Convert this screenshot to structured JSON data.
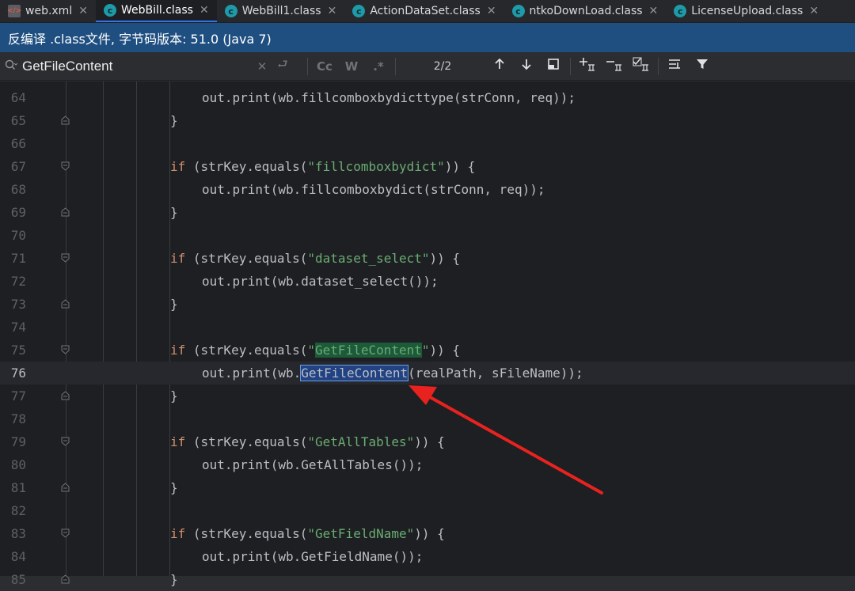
{
  "tabs": [
    {
      "label": "web.xml",
      "icon": "xml-file-icon",
      "active": false
    },
    {
      "label": "WebBill.class",
      "icon": "class-file-icon",
      "active": true
    },
    {
      "label": "WebBill1.class",
      "icon": "class-file-icon",
      "active": false
    },
    {
      "label": "ActionDataSet.class",
      "icon": "class-file-icon",
      "active": false
    },
    {
      "label": "ntkoDownLoad.class",
      "icon": "class-file-icon",
      "active": false
    },
    {
      "label": "LicenseUpload.class",
      "icon": "class-file-icon",
      "active": false
    }
  ],
  "banner": {
    "text": "反编译 .class文件, 字节码版本: 51.0 (Java 7)"
  },
  "search": {
    "query": "GetFileContent",
    "match_case_label": "Cc",
    "words_label": "W",
    "regex_label": ".*",
    "match_count": "2/2"
  },
  "icons": {
    "search": "search-icon",
    "clear": "close-icon",
    "history": "replace-icon",
    "prev": "arrow-up-icon",
    "next": "arrow-down-icon",
    "window": "open-in-window-icon",
    "add_occurrence": "add-occurrence-icon",
    "remove_occurrence": "remove-occurrence-icon",
    "select_all": "select-all-occurrences-icon",
    "filter_options": "filter-options-icon",
    "filter": "filter-icon"
  },
  "colors": {
    "banner": "#1f4f80",
    "keyword": "#cf8e6d",
    "string": "#6aab73",
    "selection": "#214283",
    "arrow": "#e8231f"
  },
  "editor": {
    "lines": [
      {
        "num": "64",
        "indent": 1,
        "parts": [
          {
            "t": "out.print(wb.fillcomboxbydicttype(strConn, req));",
            "c": ""
          }
        ]
      },
      {
        "num": "65",
        "indent": 0,
        "parts": [
          {
            "t": "}",
            "c": ""
          }
        ]
      },
      {
        "num": "66",
        "indent": 0,
        "parts": []
      },
      {
        "num": "67",
        "indent": 0,
        "parts": [
          {
            "t": "if",
            "c": "kw"
          },
          {
            "t": " (strKey.equals(",
            "c": ""
          },
          {
            "t": "\"fillcomboxbydict\"",
            "c": "str"
          },
          {
            "t": ")) {",
            "c": ""
          }
        ]
      },
      {
        "num": "68",
        "indent": 1,
        "parts": [
          {
            "t": "out.print(wb.fillcomboxbydict(strConn, req));",
            "c": ""
          }
        ]
      },
      {
        "num": "69",
        "indent": 0,
        "parts": [
          {
            "t": "}",
            "c": ""
          }
        ]
      },
      {
        "num": "70",
        "indent": 0,
        "parts": []
      },
      {
        "num": "71",
        "indent": 0,
        "parts": [
          {
            "t": "if",
            "c": "kw"
          },
          {
            "t": " (strKey.equals(",
            "c": ""
          },
          {
            "t": "\"dataset_select\"",
            "c": "str"
          },
          {
            "t": ")) {",
            "c": ""
          }
        ]
      },
      {
        "num": "72",
        "indent": 1,
        "parts": [
          {
            "t": "out.print(wb.dataset_select());",
            "c": ""
          }
        ]
      },
      {
        "num": "73",
        "indent": 0,
        "parts": [
          {
            "t": "}",
            "c": ""
          }
        ]
      },
      {
        "num": "74",
        "indent": 0,
        "parts": []
      },
      {
        "num": "75",
        "indent": 0,
        "parts": [
          {
            "t": "if",
            "c": "kw"
          },
          {
            "t": " (strKey.equals(",
            "c": ""
          },
          {
            "t": "\"",
            "c": "str"
          },
          {
            "t": "GetFileContent",
            "c": "hl-search"
          },
          {
            "t": "\"",
            "c": "str"
          },
          {
            "t": ")) {",
            "c": ""
          }
        ]
      },
      {
        "num": "76",
        "indent": 1,
        "current": true,
        "parts": [
          {
            "t": "out.print(wb.",
            "c": ""
          },
          {
            "t": "GetFileContent",
            "c": "hl-select"
          },
          {
            "t": "(realPath, sFileName));",
            "c": ""
          }
        ]
      },
      {
        "num": "77",
        "indent": 0,
        "parts": [
          {
            "t": "}",
            "c": ""
          }
        ]
      },
      {
        "num": "78",
        "indent": 0,
        "parts": []
      },
      {
        "num": "79",
        "indent": 0,
        "parts": [
          {
            "t": "if",
            "c": "kw"
          },
          {
            "t": " (strKey.equals(",
            "c": ""
          },
          {
            "t": "\"GetAllTables\"",
            "c": "str"
          },
          {
            "t": ")) {",
            "c": ""
          }
        ]
      },
      {
        "num": "80",
        "indent": 1,
        "parts": [
          {
            "t": "out.print(wb.GetAllTables());",
            "c": ""
          }
        ]
      },
      {
        "num": "81",
        "indent": 0,
        "parts": [
          {
            "t": "}",
            "c": ""
          }
        ]
      },
      {
        "num": "82",
        "indent": 0,
        "parts": []
      },
      {
        "num": "83",
        "indent": 0,
        "parts": [
          {
            "t": "if",
            "c": "kw"
          },
          {
            "t": " (strKey.equals(",
            "c": ""
          },
          {
            "t": "\"GetFieldName\"",
            "c": "str"
          },
          {
            "t": ")) {",
            "c": ""
          }
        ]
      },
      {
        "num": "84",
        "indent": 1,
        "parts": [
          {
            "t": "out.print(wb.GetFieldName());",
            "c": ""
          }
        ]
      },
      {
        "num": "85",
        "indent": 0,
        "parts": [
          {
            "t": "}",
            "c": ""
          }
        ]
      }
    ]
  }
}
